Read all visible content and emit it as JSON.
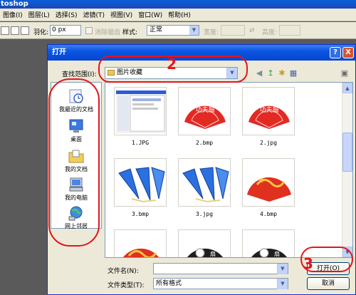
{
  "app": {
    "title": "toshop"
  },
  "menubar": [
    "图像(I)",
    "图层(L)",
    "选择(S)",
    "滤镜(T)",
    "视图(V)",
    "窗口(W)",
    "帮助(H)"
  ],
  "options_bar": {
    "feather_label": "羽化:",
    "feather_value": "0 px",
    "antialias_label": "消除锯齿",
    "style_label": "样式:",
    "style_value": "正常",
    "width_label": "宽度:",
    "height_label": "高度:"
  },
  "dialog": {
    "title": "打开",
    "help_glyph": "?",
    "close_glyph": "X",
    "lookin_label": "查找范围(I):",
    "lookin_value": "图片收藏",
    "places": [
      {
        "label": "我最近的文档",
        "icon": "recent-documents-icon"
      },
      {
        "label": "桌面",
        "icon": "desktop-icon"
      },
      {
        "label": "我的文档",
        "icon": "my-documents-icon"
      },
      {
        "label": "我的电脑",
        "icon": "my-computer-icon"
      },
      {
        "label": "网上邻居",
        "icon": "network-places-icon"
      }
    ],
    "files": [
      {
        "name": "1.JPG",
        "thumb": "screenshot"
      },
      {
        "name": "2.bmp",
        "thumb": "red-fan"
      },
      {
        "name": "2.jpg",
        "thumb": "red-fan"
      },
      {
        "name": "3.bmp",
        "thumb": "blue-fans"
      },
      {
        "name": "3.jpg",
        "thumb": "blue-fans"
      },
      {
        "name": "4.bmp",
        "thumb": "red-dragon-fan"
      },
      {
        "name": "",
        "thumb": "red-dragon-fan"
      },
      {
        "name": "",
        "thumb": "black-fan"
      },
      {
        "name": "",
        "thumb": "black-fan"
      }
    ],
    "filename_label": "文件名(N):",
    "filename_value": "",
    "filetype_label": "文件类型(T):",
    "filetype_value": "所有格式",
    "open_button": "打开(O)",
    "cancel_button": "取消"
  },
  "annotations": [
    "2",
    "3"
  ],
  "colors": {
    "annotation": "#e4141b",
    "xp_blue": "#0a55e2",
    "dialog_bg": "#ece9d8"
  }
}
